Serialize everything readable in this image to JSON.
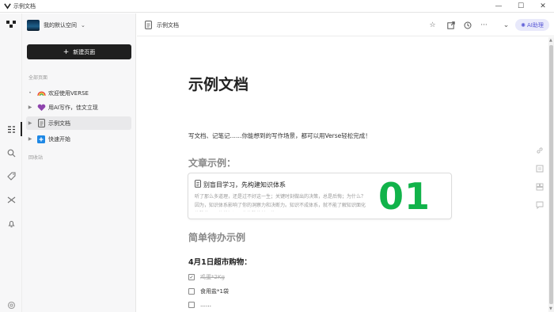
{
  "window": {
    "title": "示例文档",
    "controls": {
      "minimize": "—",
      "maximize": "☐",
      "close": "✕"
    }
  },
  "rail": {
    "icons": [
      "logo-icon",
      "tree-icon",
      "search-icon",
      "tag-icon",
      "shuffle-icon",
      "bell-icon",
      "settings-icon"
    ]
  },
  "sidebar": {
    "workspace_name": "我的默认空间",
    "new_page_label": "新建页面",
    "section_all_pages": "全部页面",
    "section_trash": "回收站",
    "items": [
      {
        "label": "欢迎使用VERSE",
        "icon": "rainbow-icon",
        "has_caret": false
      },
      {
        "label": "用AI写作，佳文立现",
        "icon": "purple-heart-icon",
        "has_caret": true
      },
      {
        "label": "示例文档",
        "icon": "document-icon",
        "has_caret": true,
        "active": true
      },
      {
        "label": "快速开始",
        "icon": "blue-block-icon",
        "has_caret": true
      }
    ]
  },
  "doc_header": {
    "title": "示例文档",
    "ai_label": "AI助理"
  },
  "doc": {
    "title": "示例文档",
    "intro": "写文档、记笔记……你能想到的写作场景，都可以用Verse轻松完成！",
    "article_heading": "文章示例：",
    "card": {
      "title": "别盲目学习，先构建知识体系",
      "description": "听了那么多道理，还是过不好这一生；关键时刻做出的决策，总是后悔；为什么？因为，知识体系影响了你的洞察力和决断力。知识不成体系，就不能了解知识面化的脉络；不搞懂知识面化的脉络就不能…",
      "number": "01"
    },
    "todo_heading": "简单待办示例",
    "list_heading": "4月1日超市购物：",
    "todos": [
      {
        "label": "鸡蛋*2Kg",
        "checked": true
      },
      {
        "label": "食用盐*1袋",
        "checked": false
      },
      {
        "label": "……",
        "checked": false
      }
    ]
  },
  "colors": {
    "accent_green": "#11b34a",
    "ai_purple": "#5b5bd6",
    "new_page_bg": "#1f1f1f"
  }
}
